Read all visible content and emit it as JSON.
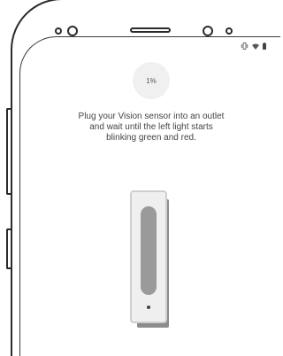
{
  "status_bar": {
    "icons": [
      "vibrate-icon",
      "wifi-icon",
      "battery-icon"
    ]
  },
  "progress": {
    "label": "1%",
    "value": 0.01
  },
  "instruction": {
    "text": "Plug your Vision sensor into an outlet\nand wait until the left light starts\nblinking green and red."
  }
}
